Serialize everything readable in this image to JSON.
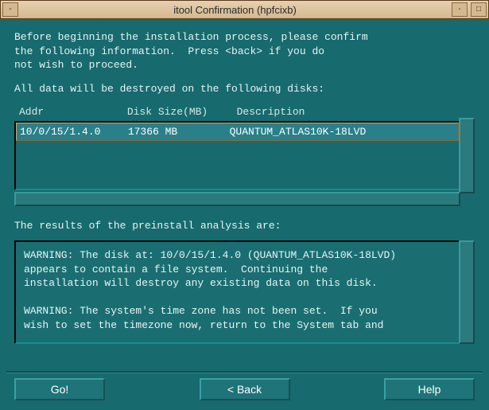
{
  "window": {
    "title": "itool Confirmation (hpfcixb)"
  },
  "intro": "Before beginning the installation process, please confirm\nthe following information.  Press <back> if you do\nnot wish to proceed.",
  "destroy_line": "All data will be destroyed on the following disks:",
  "table": {
    "headers": {
      "addr": "Addr",
      "size": "Disk Size(MB)",
      "desc": "Description"
    },
    "rows": [
      {
        "addr": "10/0/15/1.4.0",
        "size": "17366 MB",
        "desc": "QUANTUM_ATLAS10K-18LVD"
      }
    ]
  },
  "results_label": "The results of the preinstall analysis are:",
  "results_text": "WARNING: The disk at: 10/0/15/1.4.0 (QUANTUM_ATLAS10K-18LVD)\nappears to contain a file system.  Continuing the\ninstallation will destroy any existing data on this disk.\n\nWARNING: The system's time zone has not been set.  If you\nwish to set the timezone now, return to the System tab and",
  "buttons": {
    "go": "Go!",
    "back": "< Back",
    "help": "Help"
  }
}
